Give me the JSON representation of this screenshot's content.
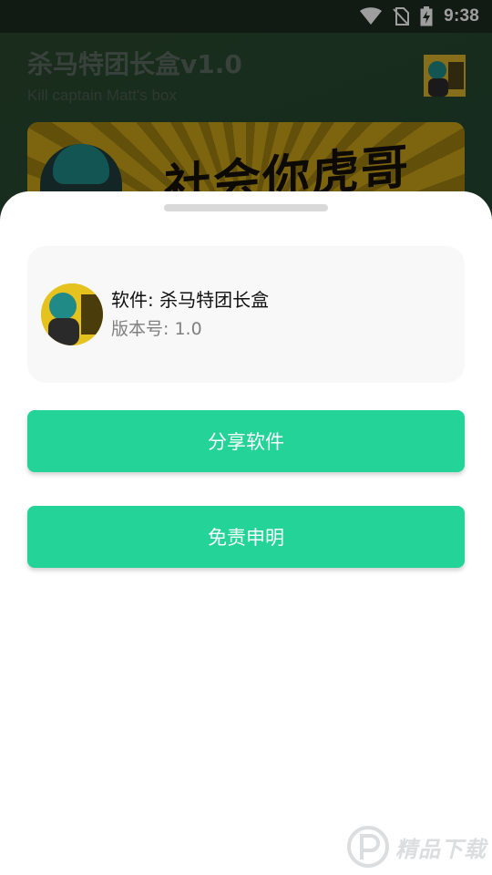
{
  "status_bar": {
    "time": "9:38"
  },
  "app": {
    "title": "杀马特团长盒v1.0",
    "subtitle": "Kill captain Matt's box",
    "banner_text": "社会你虎哥"
  },
  "sheet": {
    "software_label": "软件: 杀马特团长盒",
    "version_label": "版本号: 1.0",
    "share_button": "分享软件",
    "disclaimer_button": "免责申明"
  },
  "watermark": {
    "text": "精品下载"
  },
  "colors": {
    "accent": "#23d398",
    "card_bg": "#f8f8f8",
    "scrim": "rgba(0,0,0,0.38)"
  }
}
